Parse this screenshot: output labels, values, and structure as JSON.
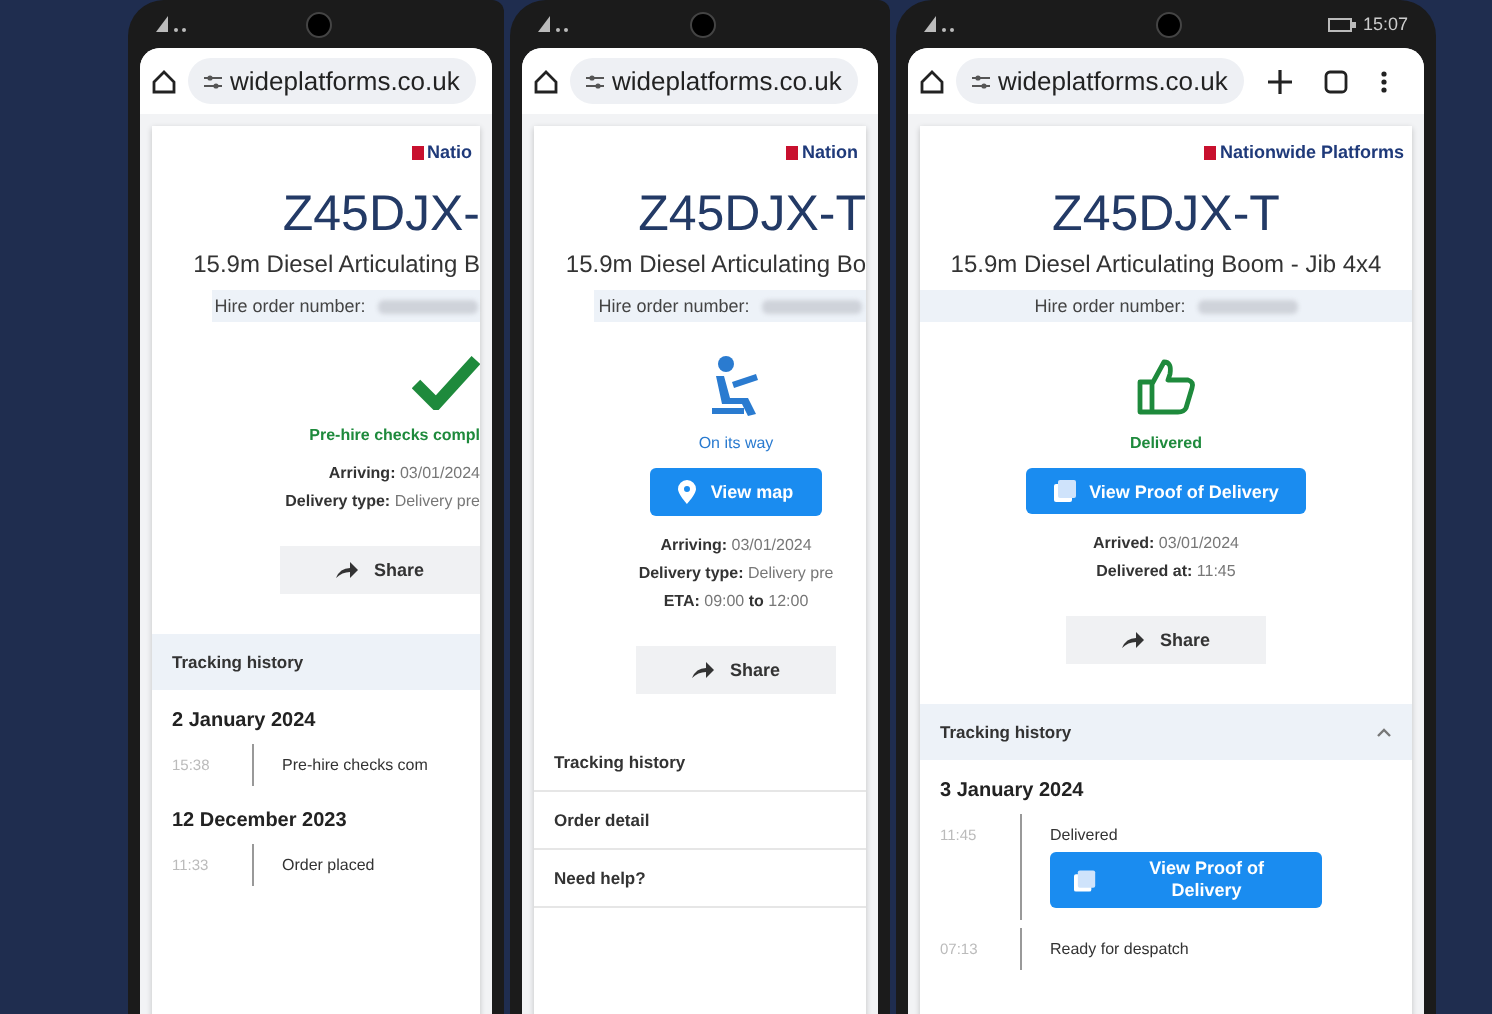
{
  "phones": [
    {
      "url": "wideplatforms.co.uk",
      "browser_actions": false,
      "logo": "Natio",
      "plate": "Z45DJX-",
      "model": "15.9m Diesel Articulating B",
      "order_label": "Hire order number:",
      "status": {
        "kind": "check",
        "text": "Pre-hire checks compl"
      },
      "details": [
        "**Arriving:** 03/01/2024",
        "**Delivery type:** Delivery pre"
      ],
      "share": "Share",
      "sections": [
        {
          "title": "Tracking history",
          "expanded": true,
          "days": [
            {
              "date": "2 January 2024",
              "events": [
                {
                  "time": "15:38",
                  "text": "Pre-hire checks com"
                }
              ]
            },
            {
              "date": "12 December 2023",
              "events": [
                {
                  "time": "11:33",
                  "text": "Order placed"
                }
              ]
            }
          ]
        }
      ]
    },
    {
      "url": "wideplatforms.co.uk",
      "browser_actions": false,
      "logo": "Nation",
      "plate": "Z45DJX-T",
      "model": "15.9m Diesel Articulating Bo",
      "order_label": "Hire order number:",
      "status": {
        "kind": "driver",
        "text": "On its way"
      },
      "action_button": {
        "kind": "map",
        "label": "View map"
      },
      "details": [
        "**Arriving:** 03/01/2024",
        "**Delivery type:** Delivery pre",
        "**ETA:** 09:00 **to** 12:00"
      ],
      "share": "Share",
      "sections": [
        {
          "title": "Tracking history",
          "expanded": false
        },
        {
          "title": "Order detail",
          "expanded": false
        },
        {
          "title": "Need help?",
          "expanded": false
        }
      ]
    },
    {
      "status_time": "15:07",
      "url": "wideplatforms.co.uk",
      "browser_actions": true,
      "logo": "Nationwide Platforms",
      "plate": "Z45DJX-T",
      "model": "15.9m Diesel Articulating Boom - Jib 4x4",
      "order_label": "Hire order number:",
      "status": {
        "kind": "thumb",
        "text": "Delivered"
      },
      "action_button": {
        "kind": "proof",
        "label": "View Proof of Delivery"
      },
      "details": [
        "**Arrived:** 03/01/2024",
        "**Delivered at:** 11:45"
      ],
      "share": "Share",
      "sections": [
        {
          "title": "Tracking history",
          "expanded": true,
          "days": [
            {
              "date": "3 January 2024",
              "events": [
                {
                  "time": "11:45",
                  "text": "Delivered",
                  "button": "View Proof of Delivery"
                },
                {
                  "time": "07:13",
                  "text": "Ready for despatch"
                }
              ]
            }
          ]
        }
      ]
    }
  ]
}
